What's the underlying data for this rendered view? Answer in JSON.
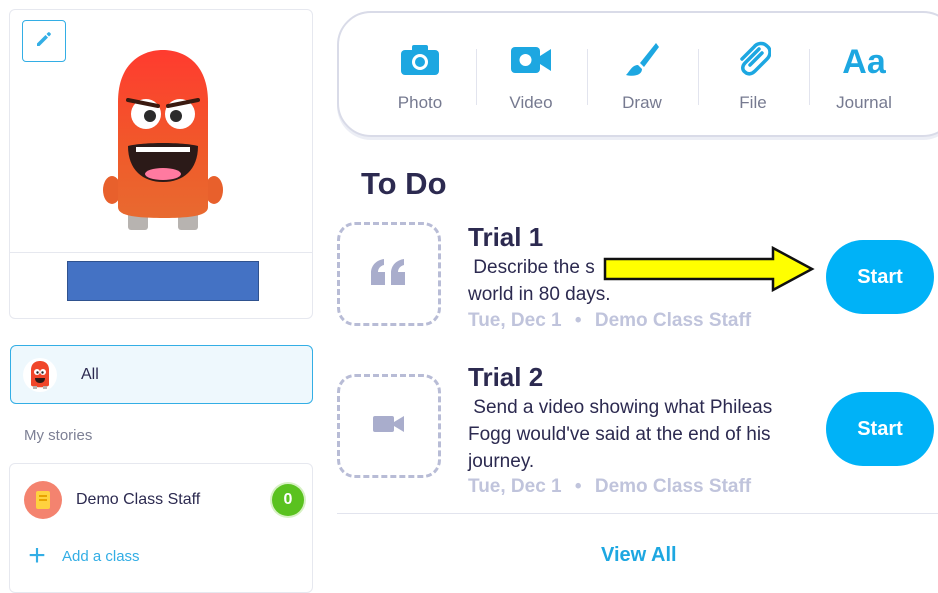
{
  "profile": {
    "edit_icon": "pencil-icon",
    "avatar_icon": "red-monster-avatar",
    "name_redacted": true
  },
  "filter": {
    "all_label": "All"
  },
  "stories": {
    "section_label": "My stories",
    "classes": [
      {
        "name": "Demo Class Staff",
        "badge": "0",
        "icon": "notebook-icon"
      }
    ],
    "add_class_label": "Add a class"
  },
  "toolbar": {
    "items": [
      {
        "label": "Photo",
        "icon": "camera-icon"
      },
      {
        "label": "Video",
        "icon": "video-camera-icon"
      },
      {
        "label": "Draw",
        "icon": "paintbrush-icon"
      },
      {
        "label": "File",
        "icon": "paperclip-icon"
      },
      {
        "label": "Journal",
        "icon": "aa-icon",
        "glyph": "Aa"
      }
    ]
  },
  "todo": {
    "title": "To Do",
    "items": [
      {
        "title": "Trial 1",
        "description": " Describe the s",
        "description_line2": "world in 80 days.",
        "date": "Tue, Dec 1",
        "separator": "•",
        "author": "Demo Class Staff",
        "icon": "quote-icon",
        "button": "Start"
      },
      {
        "title": "Trial 2",
        "description": " Send a video showing what Phileas Fogg would've said at the end of his journey.",
        "date": "Tue, Dec 1",
        "separator": "•",
        "author": "Demo Class Staff",
        "icon": "video-icon",
        "button": "Start"
      }
    ],
    "view_all": "View All"
  },
  "colors": {
    "accent": "#1da7e1",
    "start_button": "#00b2f7",
    "title_text": "#2c2a50",
    "meta_text": "#c0c4dc",
    "annotation_arrow": "#ffff00"
  }
}
